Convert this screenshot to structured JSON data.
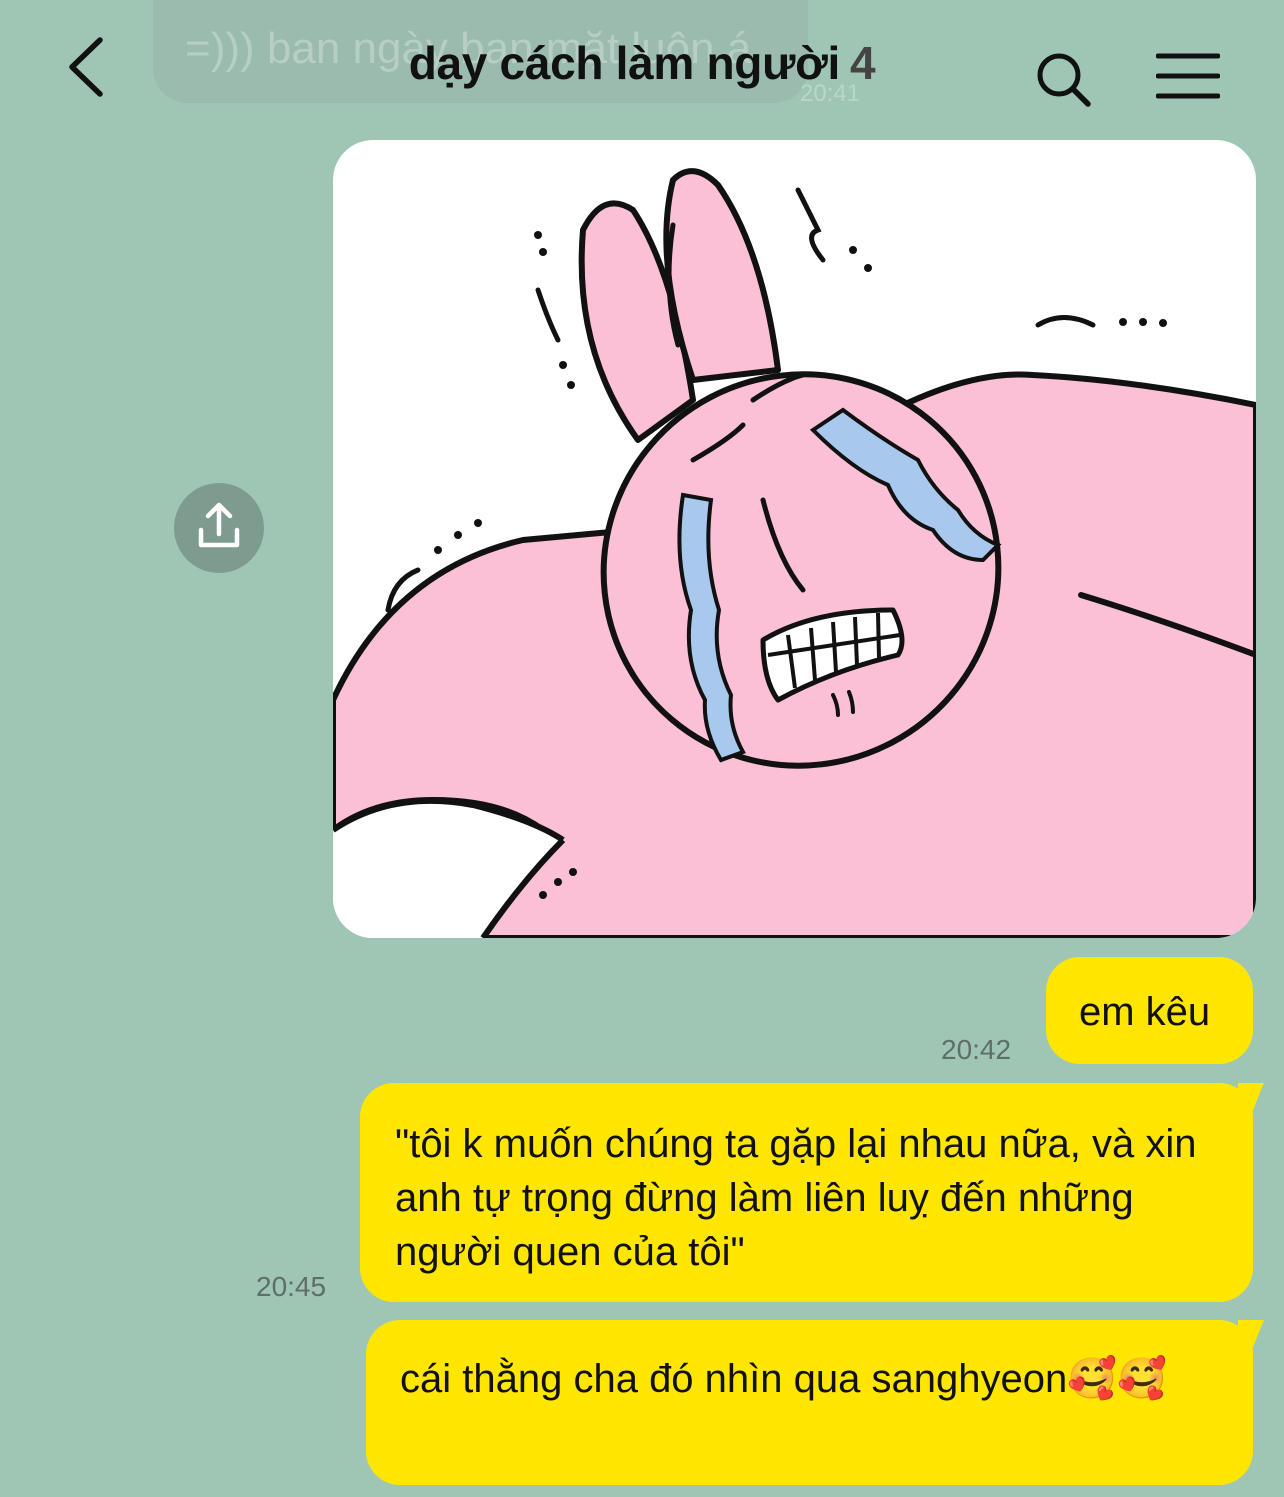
{
  "header": {
    "title": "dạy cách làm người",
    "member_count": "4",
    "back_icon": "chevron-left-icon",
    "search_icon": "search-icon",
    "menu_icon": "hamburger-menu-icon"
  },
  "ghost_previous_message": {
    "text": "=))) ban ngày ban mặt luôn á",
    "time": "20:41"
  },
  "sticker": {
    "description_icon": "crying-pink-rabbit-sticker",
    "share_icon": "share-upload-icon"
  },
  "messages": [
    {
      "text": "em kêu",
      "time": "20:42"
    },
    {
      "text": "\"tôi k muốn chúng ta gặp lại nhau nữa, và xin anh tự trọng đừng làm liên luỵ đến những người quen của tôi\"",
      "time": "20:45"
    },
    {
      "text": "cái thằng cha đó nhìn qua sanghyeon🥰🥰",
      "time": ""
    }
  ],
  "colors": {
    "background": "#9fc6b5",
    "bubble": "#ffe600",
    "sticker_pink": "#fbbfd6",
    "tear_blue": "#a9c8ee"
  }
}
